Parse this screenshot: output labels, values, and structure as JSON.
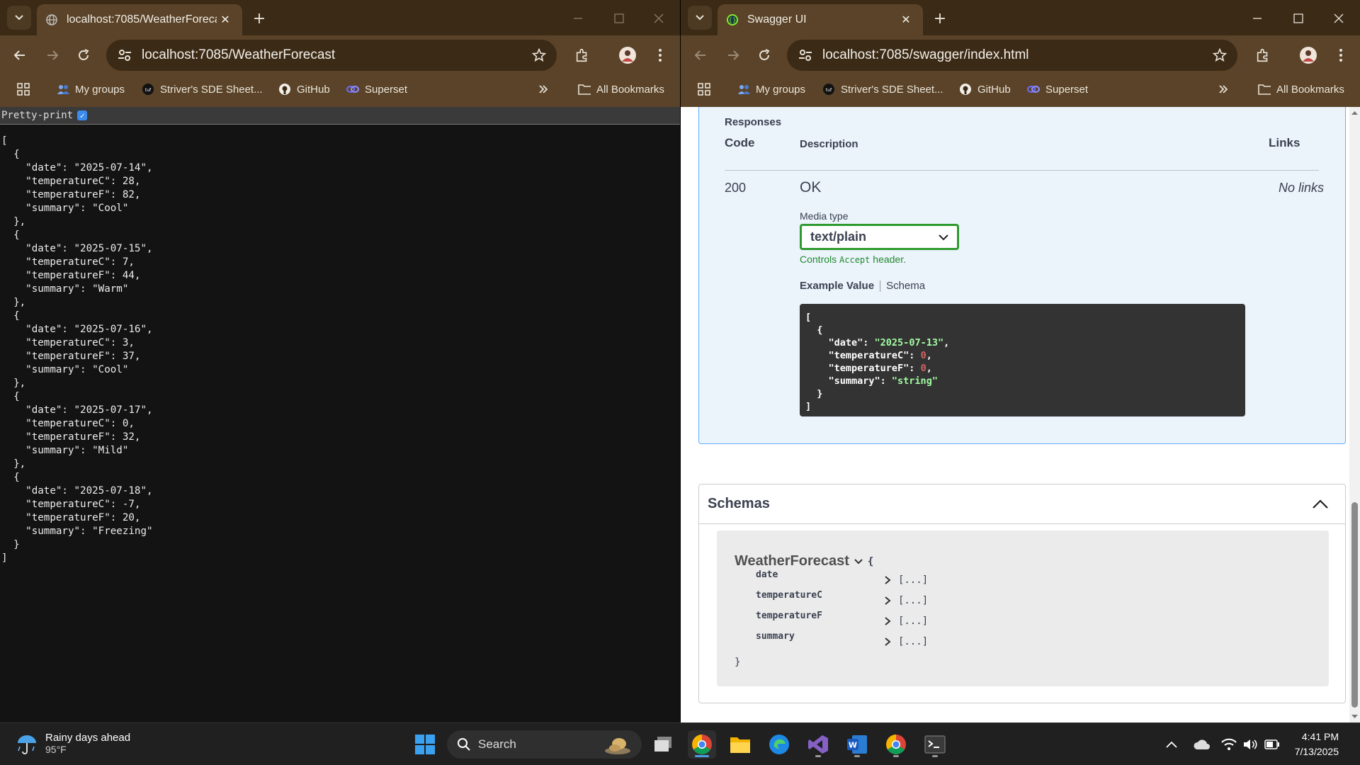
{
  "left_window": {
    "tab_title": "localhost:7085/WeatherForecast",
    "url": "localhost:7085/WeatherForecast",
    "bookmarks": [
      "My groups",
      "Striver's SDE Sheet...",
      "GitHub",
      "Superset"
    ],
    "all_bookmarks": "All Bookmarks",
    "pretty_print_label": "Pretty-print",
    "pretty_print_checked": true,
    "json_text": "[\n  {\n    \"date\": \"2025-07-14\",\n    \"temperatureC\": 28,\n    \"temperatureF\": 82,\n    \"summary\": \"Cool\"\n  },\n  {\n    \"date\": \"2025-07-15\",\n    \"temperatureC\": 7,\n    \"temperatureF\": 44,\n    \"summary\": \"Warm\"\n  },\n  {\n    \"date\": \"2025-07-16\",\n    \"temperatureC\": 3,\n    \"temperatureF\": 37,\n    \"summary\": \"Cool\"\n  },\n  {\n    \"date\": \"2025-07-17\",\n    \"temperatureC\": 0,\n    \"temperatureF\": 32,\n    \"summary\": \"Mild\"\n  },\n  {\n    \"date\": \"2025-07-18\",\n    \"temperatureC\": -7,\n    \"temperatureF\": 20,\n    \"summary\": \"Freezing\"\n  }\n]"
  },
  "right_window": {
    "tab_title": "Swagger UI",
    "url": "localhost:7085/swagger/index.html",
    "bookmarks": [
      "My groups",
      "Striver's SDE Sheet...",
      "GitHub",
      "Superset"
    ],
    "all_bookmarks": "All Bookmarks",
    "responses": {
      "heading": "Responses",
      "col_code": "Code",
      "col_description": "Description",
      "col_links": "Links",
      "code": "200",
      "description": "OK",
      "links": "No links",
      "media_type_label": "Media type",
      "media_type_value": "text/plain",
      "controls_prefix": "Controls",
      "controls_code": "Accept",
      "controls_suffix": "header.",
      "example_tab": "Example Value",
      "schema_tab": "Schema",
      "example": {
        "date": "\"2025-07-13\"",
        "temperatureC": "0",
        "temperatureF": "0",
        "summary": "\"string\""
      }
    },
    "schemas": {
      "heading": "Schemas",
      "model_name": "WeatherForecast",
      "open_brace": "{",
      "close_brace": "}",
      "properties": [
        "date",
        "temperatureC",
        "temperatureF",
        "summary"
      ],
      "collapsed_value": "[...]"
    }
  },
  "taskbar": {
    "weather_title": "Rainy days ahead",
    "weather_temp": "95°F",
    "search_label": "Search",
    "time": "4:41 PM",
    "date": "7/13/2025"
  },
  "colors": {
    "chrome_frame": "#3b2a16",
    "chrome_toolbar": "#5a4328",
    "swagger_blue_border": "#61affe",
    "swagger_blue_bg": "#ebf3fb",
    "select_border_green": "#2e9a2e",
    "example_bg": "#333333"
  }
}
